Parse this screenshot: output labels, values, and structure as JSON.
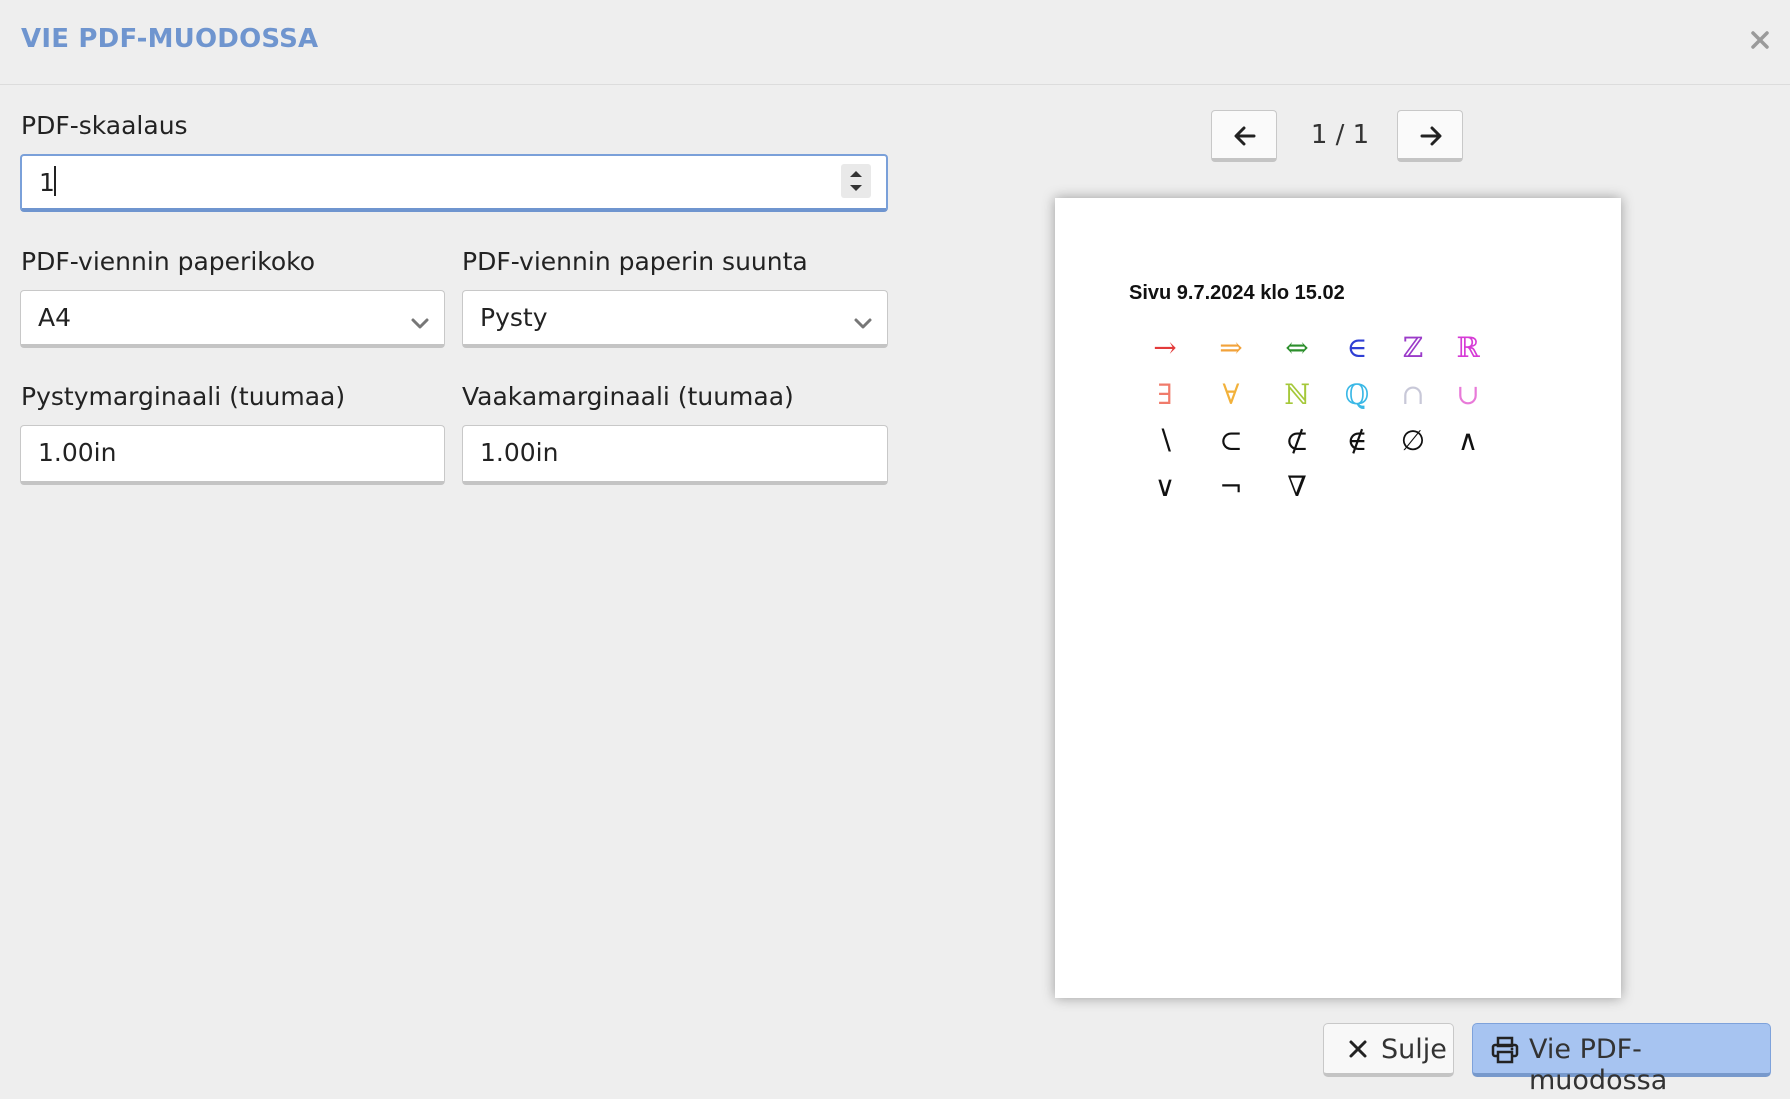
{
  "dialog": {
    "title": "VIE PDF-MUODOSSA",
    "close_icon": "close-icon"
  },
  "form": {
    "scale": {
      "label": "PDF-skaalaus",
      "value": "1"
    },
    "paper_size": {
      "label": "PDF-viennin paperikoko",
      "value": "A4"
    },
    "orientation": {
      "label": "PDF-viennin paperin suunta",
      "value": "Pysty"
    },
    "vertical_margin": {
      "label": "Pystymarginaali (tuumaa)",
      "value": "1.00in"
    },
    "horizontal_margin": {
      "label": "Vaakamarginaali (tuumaa)",
      "value": "1.00in"
    }
  },
  "preview": {
    "page_indicator": "1 / 1",
    "prev_icon": "arrow-left-icon",
    "next_icon": "arrow-right-icon",
    "page_heading": "Sivu 9.7.2024 klo 15.02",
    "symbols": [
      {
        "char": "→",
        "color": "#e33b3b"
      },
      {
        "char": "⇒",
        "color": "#f2a23a"
      },
      {
        "char": "⇔",
        "color": "#2c8f2c"
      },
      {
        "char": "∈",
        "color": "#2f3fd4"
      },
      {
        "char": "ℤ",
        "color": "#9b3bc9"
      },
      {
        "char": "ℝ",
        "color": "#d63bd6"
      },
      {
        "char": "∃",
        "color": "#f07b6b"
      },
      {
        "char": "∀",
        "color": "#f2b13a"
      },
      {
        "char": "ℕ",
        "color": "#a5c83a"
      },
      {
        "char": "ℚ",
        "color": "#3ab8e6"
      },
      {
        "char": "∩",
        "color": "#c8c8d8"
      },
      {
        "char": "∪",
        "color": "#e87ad8"
      },
      {
        "char": "∖",
        "color": "#111111"
      },
      {
        "char": "⊂",
        "color": "#111111"
      },
      {
        "char": "⊄",
        "color": "#111111"
      },
      {
        "char": "∉",
        "color": "#111111"
      },
      {
        "char": "∅",
        "color": "#111111"
      },
      {
        "char": "∧",
        "color": "#111111"
      },
      {
        "char": "∨",
        "color": "#111111"
      },
      {
        "char": "¬",
        "color": "#111111"
      },
      {
        "char": "∇",
        "color": "#111111"
      }
    ]
  },
  "buttons": {
    "close_label": "Sulje",
    "export_label": "Vie PDF-muodossa",
    "close_icon": "x-icon",
    "export_icon": "printer-icon"
  },
  "colors": {
    "accent": "#6f95cf",
    "primary_button": "#a7c4f1"
  }
}
